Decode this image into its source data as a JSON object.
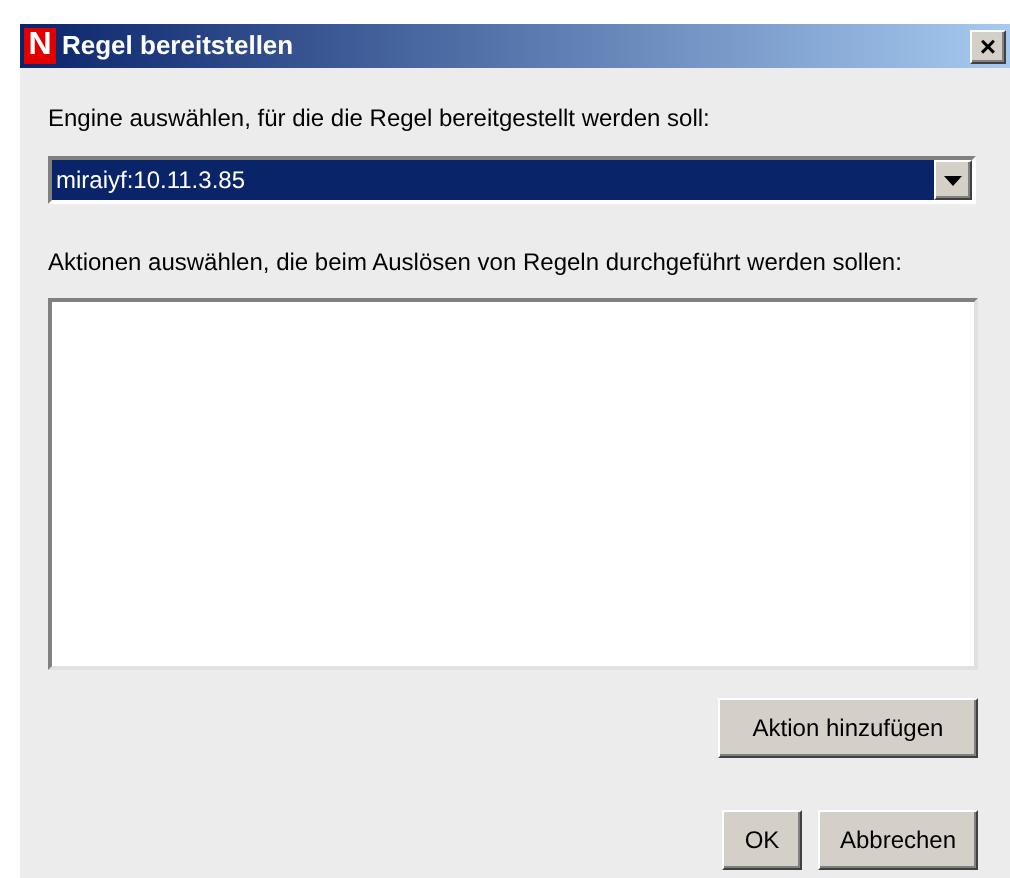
{
  "window": {
    "title": "Regel bereitstellen",
    "logo": "N",
    "close": "×"
  },
  "engine": {
    "label": "Engine auswählen, für die die Regel bereitgestellt werden soll:",
    "value": "miraiyf:10.11.3.85"
  },
  "actions": {
    "label": "Aktionen auswählen, die beim Auslösen von Regeln durchgeführt werden sollen:"
  },
  "buttons": {
    "add": "Aktion hinzufügen",
    "ok": "OK",
    "cancel": "Abbrechen"
  }
}
